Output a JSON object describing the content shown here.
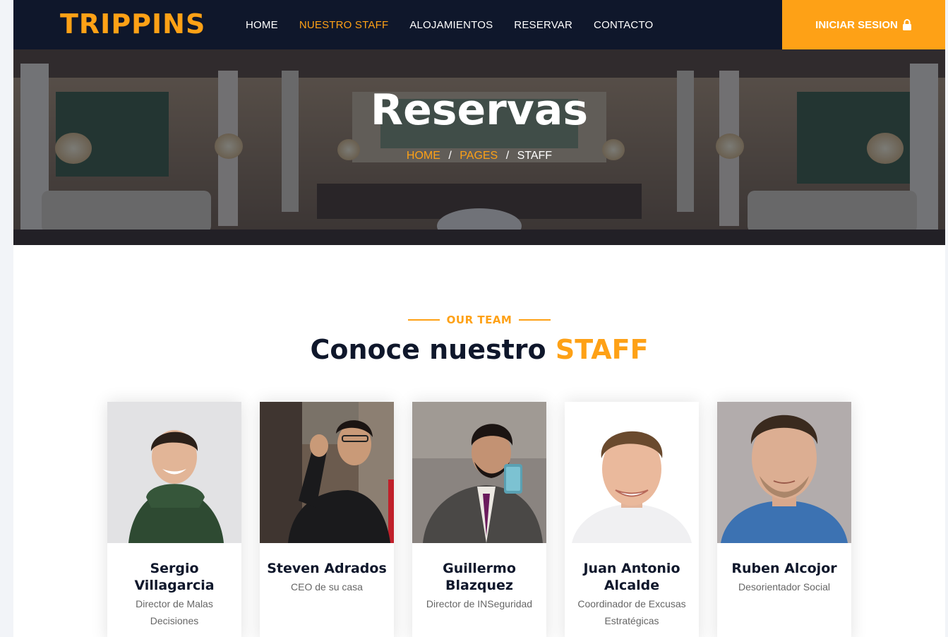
{
  "navbar": {
    "brand": "TRIPPINS",
    "links": [
      {
        "label": "HOME",
        "active": false
      },
      {
        "label": "NUESTRO STAFF",
        "active": true
      },
      {
        "label": "ALOJAMIENTOS",
        "active": false
      },
      {
        "label": "RESERVAR",
        "active": false
      },
      {
        "label": "CONTACTO",
        "active": false
      }
    ],
    "login_label": "INICIAR SESION",
    "login_icon": "lock-icon"
  },
  "hero": {
    "title": "Reservas",
    "breadcrumb": [
      "HOME",
      "PAGES",
      "STAFF"
    ],
    "separator": "/"
  },
  "team": {
    "tag": "OUR TEAM",
    "title_main": "Conoce nuestro ",
    "title_highlight": "STAFF",
    "members": [
      {
        "name": "Sergio Villagarcia",
        "role": "Director de Malas Decisiones"
      },
      {
        "name": "Steven Adrados",
        "role": "CEO de su casa"
      },
      {
        "name": "Guillermo Blazquez",
        "role": "Director de INSeguridad"
      },
      {
        "name": "Juan Antonio Alcalde",
        "role": "Coordinador de Excusas Estratégicas"
      },
      {
        "name": "Ruben Alcojor",
        "role": "Desorientador Social"
      }
    ]
  },
  "colors": {
    "primary": "#fea116",
    "dark": "#0f172b",
    "white": "#ffffff"
  }
}
